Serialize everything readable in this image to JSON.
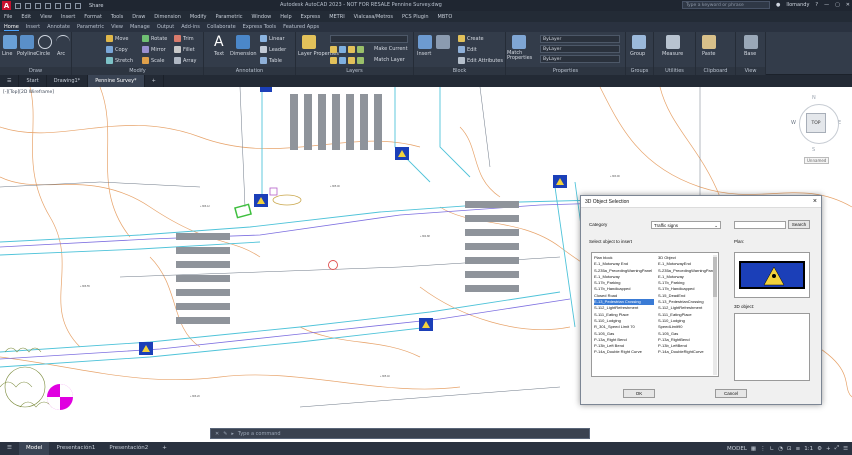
{
  "titlebar": {
    "logo": "A",
    "share": "Share",
    "title": "Autodesk AutoCAD 2023 - NOT FOR RESALE   Pennine Survey.dwg",
    "keyword_placeholder": "Type a keyword or phrase",
    "user": "llomandy"
  },
  "menubar": [
    "File",
    "Edit",
    "View",
    "Insert",
    "Format",
    "Tools",
    "Draw",
    "Dimension",
    "Modify",
    "Parametric",
    "Window",
    "Help",
    "Express",
    "METRI",
    "Vialcasa/Metros",
    "PCS Plugin",
    "MBTO"
  ],
  "ribbon_tabs": [
    "Home",
    "Insert",
    "Annotate",
    "Parametric",
    "View",
    "Manage",
    "Output",
    "Add-ins",
    "Collaborate",
    "Express Tools",
    "Featured Apps"
  ],
  "ribbon": {
    "draw": {
      "label": "Draw",
      "tools": [
        "Line",
        "Polyline",
        "Circle",
        "Arc"
      ]
    },
    "modify": {
      "label": "Modify",
      "tools": [
        "Move",
        "Rotate",
        "Trim",
        "Copy",
        "Mirror",
        "Fillet",
        "Stretch",
        "Scale",
        "Array"
      ]
    },
    "annotation": {
      "label": "Annotation",
      "tools": [
        "Text",
        "Dimension",
        "Linear",
        "Leader",
        "Table"
      ]
    },
    "layers": {
      "label": "Layers",
      "tools": [
        "Layer Properties",
        "Make Current",
        "Match Layer"
      ]
    },
    "block": {
      "label": "Block",
      "tools": [
        "Insert",
        "Create",
        "Edit",
        "Edit Attributes"
      ]
    },
    "properties": {
      "label": "Properties",
      "tools": [
        "Match Properties",
        "ByLayer",
        "ByLayer",
        "ByLayer"
      ]
    },
    "groups": {
      "label": "Groups",
      "tools": [
        "Group"
      ]
    },
    "utilities": {
      "label": "Utilities",
      "tools": [
        "Measure"
      ]
    },
    "clipboard": {
      "label": "Clipboard",
      "tools": [
        "Paste"
      ]
    },
    "view": {
      "label": "View",
      "tools": [
        "Base"
      ]
    }
  },
  "doc_tabs": [
    "Start",
    "Drawing1*",
    "Pennine Survey*"
  ],
  "canvas": {
    "view_label": "[-][Top][2D Wireframe]",
    "cube": {
      "top": "TOP",
      "n": "N",
      "s": "S",
      "e": "E",
      "w": "W",
      "wcs": "Unnamed"
    }
  },
  "command_placeholder": "Type a command",
  "layout_tabs": [
    "Model",
    "Presentación1",
    "Presentación2"
  ],
  "status": {
    "model": "MODEL",
    "scale": "1:1"
  },
  "dialog": {
    "title": "3D Object Selection",
    "category_label": "Category",
    "category_value": "Traffic signs",
    "search_button": "Search",
    "select_label": "Select object to insert",
    "col_plan": "Plan block",
    "col_3d": "3D Object",
    "plan_items": [
      "E-1_Motorway End",
      "S-235a_PrecedingWarningPanel",
      "E-1_Motorway",
      "S-17b_Parking",
      "S-17b_Handicapped",
      "Closed Road",
      "E-13_Pedestrian Crossing",
      "S-112_LightRefreshment",
      "S-111_Eating Place",
      "S-110_Lodging",
      "R_301_Speed Limit 70",
      "S-105_Gas",
      "P-13a_Right Bend",
      "P-13b_Left Bend",
      "P-14a_Double Right Curve"
    ],
    "obj_items": [
      "E-1_MotorwayEnd",
      "S-235a_PrecedingWarningPanel",
      "E-1_Motorway",
      "S-17b_Parking",
      "S-17b_Handicapped",
      "S-15_DeadEnd",
      "S-13_PedestrianCrossing",
      "S-112_LightRefreshment",
      "S-111_EatingPlace",
      "S-110_Lodging",
      "SpeedLimit90",
      "S-105_Gas",
      "P-13a_RightBend",
      "P-13b_LeftBend",
      "P-14a_DoubleRightCurve"
    ],
    "selected_index": 6,
    "plan_label": "Plan:",
    "obj3d_label": "3D object:",
    "ok": "OK",
    "cancel": "Cancel"
  }
}
